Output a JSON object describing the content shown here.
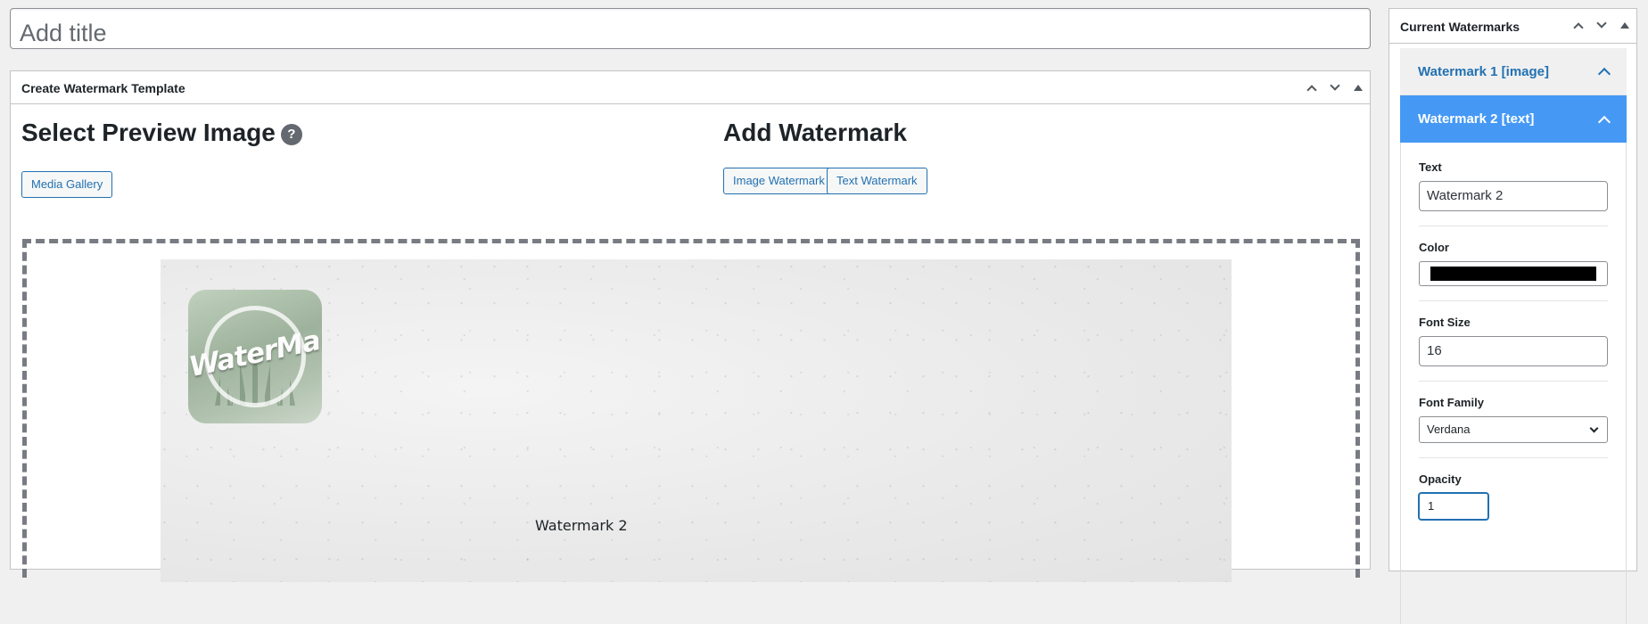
{
  "title_field": {
    "placeholder": "Add title"
  },
  "template_box": {
    "title": "Create Watermark Template",
    "select_preview": {
      "heading": "Select Preview Image",
      "help": "?",
      "media_gallery_label": "Media Gallery"
    },
    "add_watermark": {
      "heading": "Add Watermark",
      "image_watermark_label": "Image Watermark",
      "text_watermark_label": "Text Watermark"
    },
    "preview": {
      "image_watermark_text": "WaterMark",
      "text_watermark": "Watermark 2"
    }
  },
  "sidebar": {
    "title": "Current Watermarks",
    "items": [
      {
        "label": "Watermark 1 [image]",
        "expanded": false
      },
      {
        "label": "Watermark 2 [text]",
        "expanded": true
      }
    ],
    "fields": {
      "text_label": "Text",
      "text_value": "Watermark 2",
      "color_label": "Color",
      "color_value": "#000000",
      "font_size_label": "Font Size",
      "font_size_value": "16",
      "font_family_label": "Font Family",
      "font_family_value": "Verdana",
      "opacity_label": "Opacity",
      "opacity_value": "1"
    }
  },
  "colors": {
    "accent": "#2271b1",
    "active_header": "#4599f5"
  }
}
